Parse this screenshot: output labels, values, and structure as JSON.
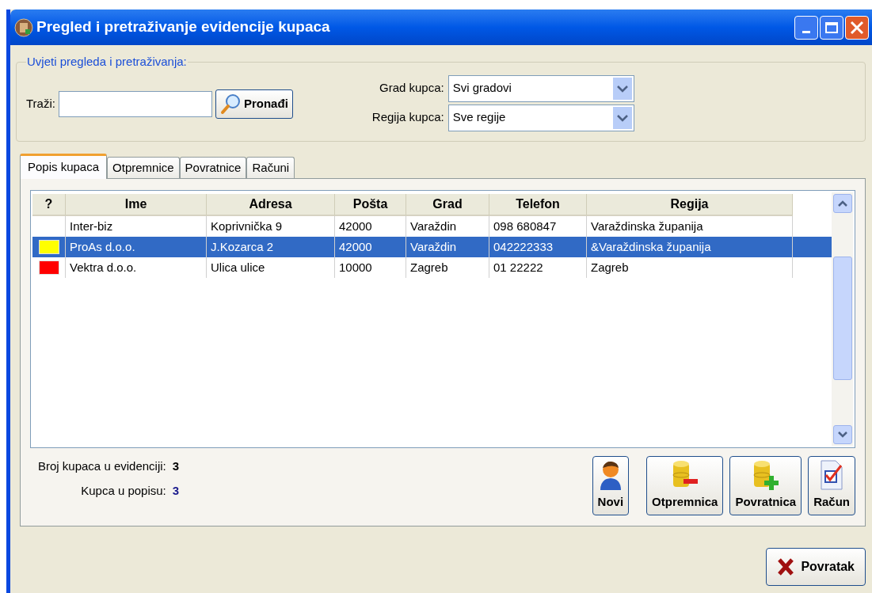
{
  "window": {
    "title": "Pregled i pretraživanje evidencije kupaca"
  },
  "filters": {
    "legend": "Uvjeti pregleda i pretraživanja:",
    "search_label": "Traži:",
    "search_button": "Pronađi",
    "city_label": "Grad kupca:",
    "city_value": "Svi gradovi",
    "region_label": "Regija kupca:",
    "region_value": "Sve regije"
  },
  "tabs": [
    {
      "label": "Popis kupaca",
      "selected": true
    },
    {
      "label": "Otpremnice",
      "selected": false
    },
    {
      "label": "Povratnice",
      "selected": false
    },
    {
      "label": "Računi",
      "selected": false
    }
  ],
  "table": {
    "columns": [
      "?",
      "Ime",
      "Adresa",
      "Pošta",
      "Grad",
      "Telefon",
      "Regija"
    ],
    "rows": [
      {
        "selected": false,
        "cells": [
          "",
          "Inter-biz",
          "Koprivnička 9",
          "42000",
          "Varaždin",
          "098 680847",
          "Varaždinska županija"
        ]
      },
      {
        "selected": true,
        "color": "#ffff00",
        "cells": [
          "",
          "ProAs d.o.o.",
          "J.Kozarca 2",
          "42000",
          "Varaždin",
          "042222333",
          "&Varaždinska županija"
        ]
      },
      {
        "selected": false,
        "color": "#ff0000",
        "cells": [
          "",
          "Vektra d.o.o.",
          "Ulica ulice",
          "10000",
          "Zagreb",
          "01 22222",
          "Zagreb"
        ]
      }
    ]
  },
  "summary": [
    {
      "label": "Broj kupaca u evidenciji:",
      "value": "3",
      "kind": "total"
    },
    {
      "label": "Kupca u popisu:",
      "value": "3",
      "kind": "listed"
    }
  ],
  "actions": [
    {
      "label": "Novi",
      "kind": "person"
    },
    {
      "label": "Otpremnica",
      "kind": "db-minus"
    },
    {
      "label": "Povratnica",
      "kind": "db-plus"
    },
    {
      "label": "Račun",
      "kind": "document"
    }
  ],
  "footer_button": "Povratak"
}
